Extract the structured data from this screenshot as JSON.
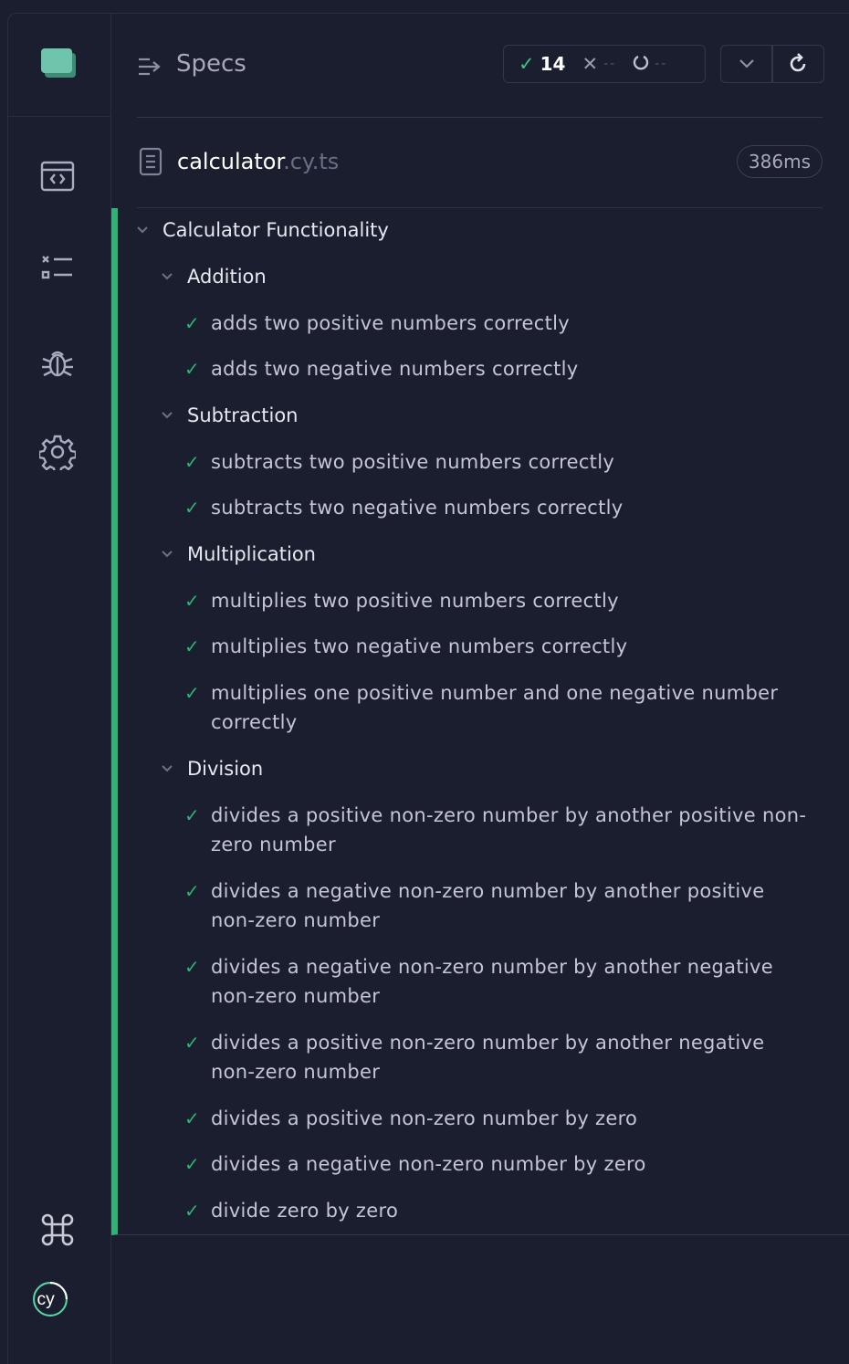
{
  "header": {
    "title": "Specs",
    "stats": {
      "passed": "14",
      "failed": "--",
      "pending": "--"
    }
  },
  "file": {
    "name": "calculator",
    "ext": ".cy.ts",
    "duration": "386ms"
  },
  "suite": {
    "title": "Calculator Functionality",
    "groups": [
      {
        "title": "Addition",
        "tests": [
          "adds two positive numbers correctly",
          "adds two negative numbers correctly"
        ]
      },
      {
        "title": "Subtraction",
        "tests": [
          "subtracts two positive numbers correctly",
          "subtracts two negative numbers correctly"
        ]
      },
      {
        "title": "Multiplication",
        "tests": [
          "multiplies two positive numbers correctly",
          "multiplies two negative numbers correctly",
          "multiplies one positive number and one negative number correctly"
        ]
      },
      {
        "title": "Division",
        "tests": [
          "divides a positive non-zero number by another positive non-zero number",
          "divides a negative non-zero number by another positive non-zero number",
          "divides a negative non-zero number by another negative non-zero number",
          "divides a positive non-zero number by another negative non-zero number",
          "divides a positive non-zero number by zero",
          "divides a negative non-zero number by zero",
          "divide zero by zero"
        ]
      }
    ]
  },
  "colors": {
    "pass": "#2fb273",
    "background": "#1b1e2e"
  }
}
